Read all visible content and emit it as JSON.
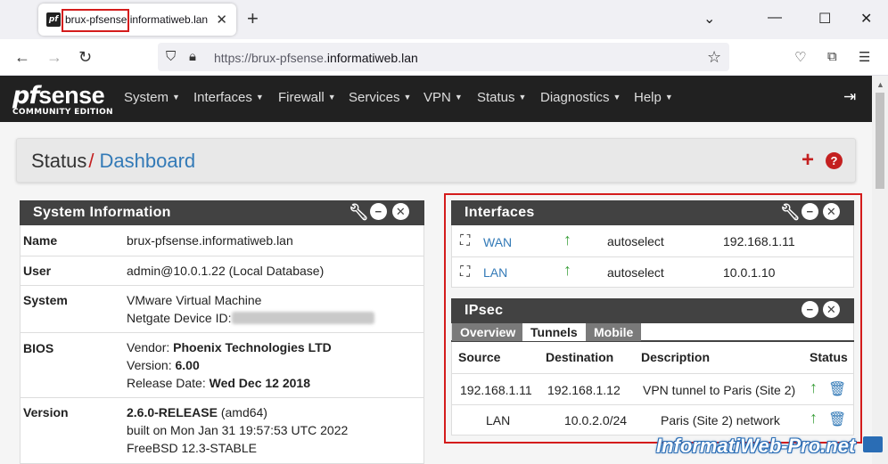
{
  "browser": {
    "tab_title": "brux-pfsense.informatiweb.lan",
    "url_scheme": "https://brux-pfsense.",
    "url_domain": "informatiweb.lan",
    "newtab": "+",
    "close": "✕"
  },
  "pfsense": {
    "logo_pf": "pf",
    "logo_sense": "sense",
    "edition": "COMMUNITY EDITION",
    "menu": [
      "System",
      "Interfaces",
      "Firewall",
      "Services",
      "VPN",
      "Status",
      "Diagnostics",
      "Help"
    ]
  },
  "breadcrumb": {
    "section": "Status",
    "page": "Dashboard"
  },
  "system_information": {
    "title": "System Information",
    "rows": {
      "name": {
        "key": "Name",
        "value": "brux-pfsense.informatiweb.lan"
      },
      "user": {
        "key": "User",
        "value": "admin@10.0.1.22 (Local Database)"
      },
      "system": {
        "key": "System",
        "line1": "VMware Virtual Machine",
        "line2": "Netgate Device ID:"
      },
      "bios": {
        "key": "BIOS",
        "vendor_label": "Vendor:",
        "vendor": "Phoenix Technologies LTD",
        "version_label": "Version:",
        "version": "6.00",
        "release_label": "Release Date:",
        "release": "Wed Dec 12 2018"
      },
      "version": {
        "key": "Version",
        "release": "2.6.0-RELEASE",
        "arch": "(amd64)",
        "built": "built on Mon Jan 31 19:57:53 UTC 2022",
        "os": "FreeBSD 12.3-STABLE"
      }
    }
  },
  "interfaces": {
    "title": "Interfaces",
    "rows": [
      {
        "name": "WAN",
        "media": "autoselect",
        "ip": "192.168.1.11"
      },
      {
        "name": "LAN",
        "media": "autoselect",
        "ip": "10.0.1.10"
      }
    ]
  },
  "ipsec": {
    "title": "IPsec",
    "tabs": [
      "Overview",
      "Tunnels",
      "Mobile"
    ],
    "columns": [
      "Source",
      "Destination",
      "Description",
      "Status"
    ],
    "rows": [
      {
        "source": "192.168.1.11",
        "destination": "192.168.1.12",
        "description": "VPN tunnel to Paris (Site 2)"
      },
      {
        "source": "LAN",
        "destination": "10.0.2.0/24",
        "description": "Paris (Site 2) network"
      }
    ]
  },
  "watermark": "InformatiWeb-Pro.net"
}
